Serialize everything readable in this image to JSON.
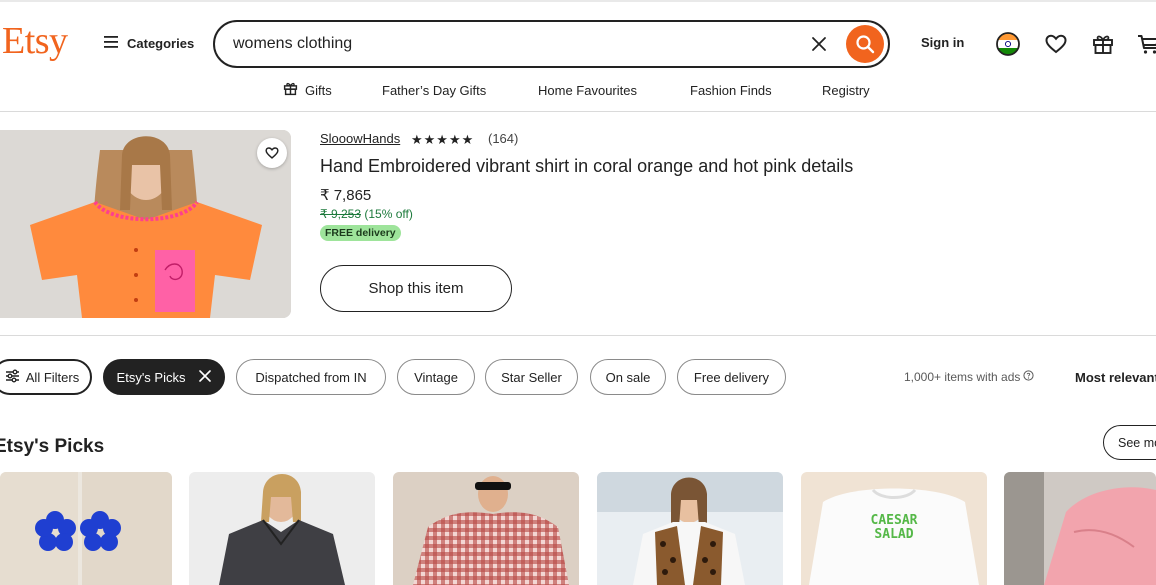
{
  "header": {
    "logo": "Etsy",
    "categories_label": "Categories",
    "search_value": "womens clothing",
    "sign_in_label": "Sign in"
  },
  "nav": {
    "items": [
      "Gifts",
      "Father’s Day Gifts",
      "Home Favourites",
      "Fashion Finds",
      "Registry"
    ]
  },
  "listing": {
    "shop_name": "SlooowHands",
    "rating": 4.5,
    "stars": "★★★★★",
    "reviews": "(164)",
    "title": "Hand Embroidered vibrant shirt in coral orange and hot pink details",
    "price": "₹ 7,865",
    "original_price": "₹ 9,253",
    "discount": "(15% off)",
    "badge": "FREE delivery",
    "cta_label": "Shop this item"
  },
  "filters": {
    "all_filters": "All Filters",
    "chips": [
      "Etsy's Picks",
      "Dispatched from IN",
      "Vintage",
      "Star Seller",
      "On sale",
      "Free delivery"
    ],
    "result_count": "1,000+ items with ads",
    "sort_label": "Most relevant"
  },
  "picks": {
    "title": "Etsy's Picks",
    "see_more": "See more"
  },
  "colors": {
    "brand_orange": "#f1641e",
    "free_delivery_green": "#9ee49b",
    "sale_green": "#1d7a3c"
  },
  "icons": [
    "hamburger-menu-icon",
    "clear-search-icon",
    "search-icon",
    "india-flag-icon",
    "heart-icon",
    "gift-icon",
    "cart-icon",
    "filter-sliders-icon",
    "info-icon",
    "close-icon"
  ]
}
